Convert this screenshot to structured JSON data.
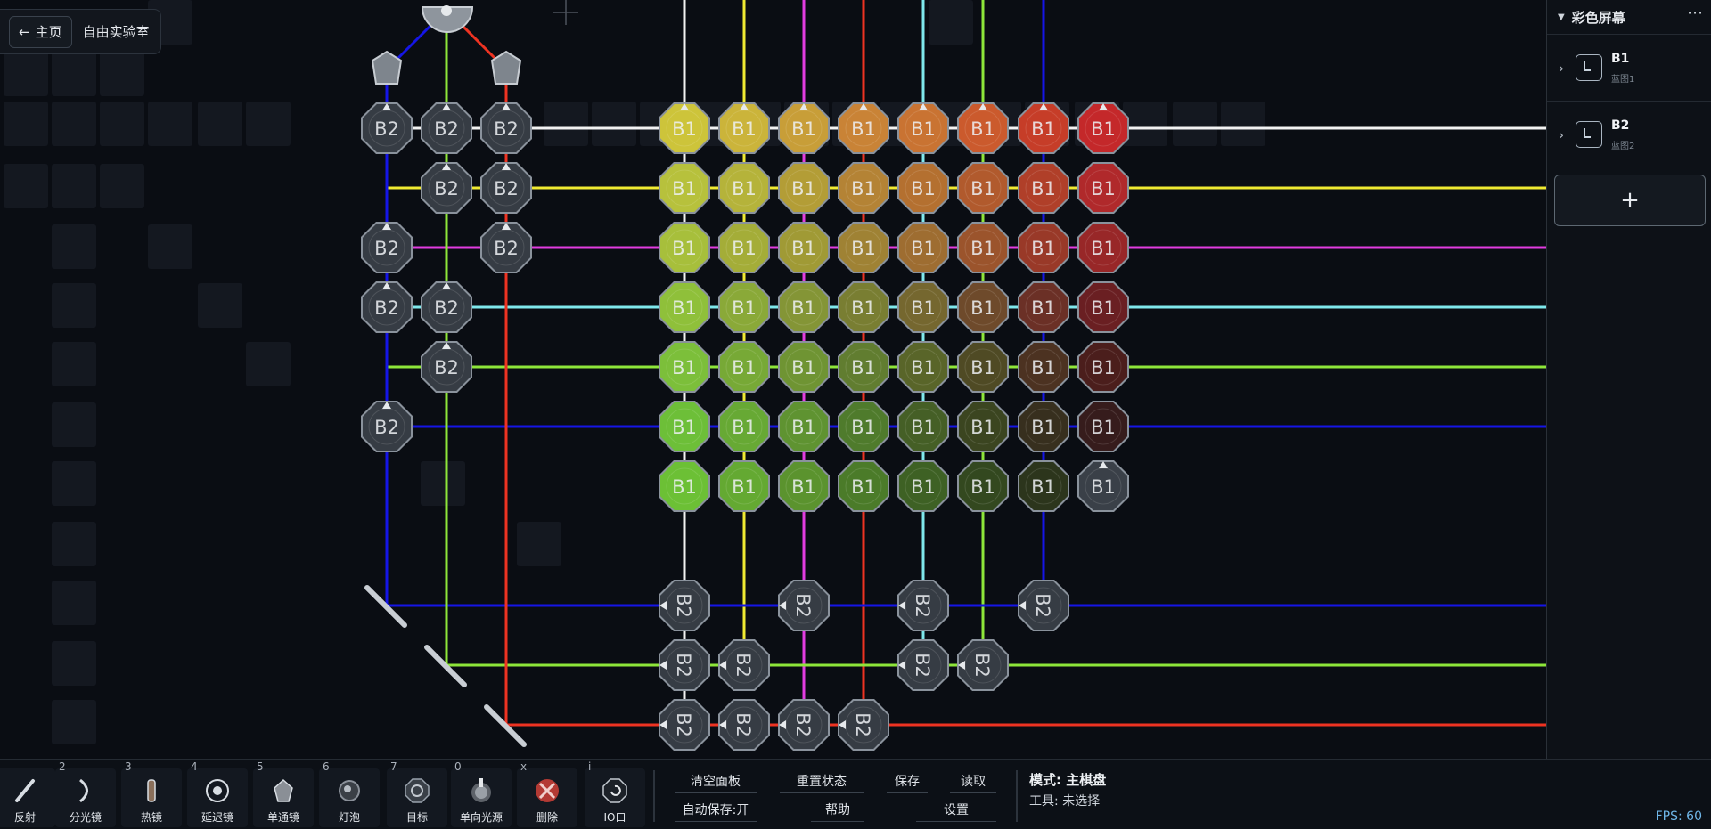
{
  "nav": {
    "home_label": "主页",
    "title": "自由实验室"
  },
  "sidebar": {
    "title": "彩色屏幕",
    "more_icon": "ellipsis-icon",
    "blueprints": [
      {
        "name": "B1",
        "sub": "蓝图1"
      },
      {
        "name": "B2",
        "sub": "蓝图2"
      }
    ],
    "add_label": "+"
  },
  "toolbar": {
    "tools": [
      {
        "key": "",
        "label": "反射",
        "icon": "mirror-icon"
      },
      {
        "key": "2",
        "label": "分光镜",
        "icon": "splitter-icon"
      },
      {
        "key": "3",
        "label": "热镜",
        "icon": "hot-mirror-icon"
      },
      {
        "key": "4",
        "label": "延迟镜",
        "icon": "delay-lens-icon"
      },
      {
        "key": "5",
        "label": "单通镜",
        "icon": "one-way-lens-icon"
      },
      {
        "key": "6",
        "label": "灯泡",
        "icon": "bulb-icon"
      },
      {
        "key": "7",
        "label": "目标",
        "icon": "target-icon"
      },
      {
        "key": "0",
        "label": "单向光源",
        "icon": "light-source-icon"
      },
      {
        "key": "x",
        "label": "删除",
        "icon": "delete-icon"
      },
      {
        "key": "i",
        "label": "IO口",
        "icon": "io-port-icon"
      }
    ],
    "controls": {
      "clear": "清空面板",
      "reset": "重置状态",
      "save": "保存",
      "load": "读取",
      "autosave": "自动保存:开",
      "help": "帮助",
      "settings": "设置"
    },
    "mode": "模式: 主棋盘",
    "tool": "工具: 未选择",
    "fps": "FPS: 60"
  },
  "board": {
    "node_labels": {
      "b1": "B1",
      "b2": "B2"
    },
    "beam_colors": {
      "white": "#f2f2f2",
      "yellow": "#f0ea32",
      "magenta": "#e23ce0",
      "red": "#ee3322",
      "cyan": "#7fe8ec",
      "green": "#8ee63a",
      "blue": "#1515e6"
    },
    "b1_colors": [
      [
        "#cdc43a",
        "#cbb43a",
        "#c89e38",
        "#c98336",
        "#c97332",
        "#cb5a2d",
        "#c63d28",
        "#c4282a"
      ],
      [
        "#b7c13c",
        "#b5b33a",
        "#b39d36",
        "#b48335",
        "#b47030",
        "#b15a2d",
        "#b03f29",
        "#b0292b"
      ],
      [
        "#a7bf3b",
        "#a4ad38",
        "#a09a35",
        "#9f8234",
        "#9e6d31",
        "#9b542c",
        "#993928",
        "#982728"
      ],
      [
        "#8fc03a",
        "#8aa938",
        "#849536",
        "#797e32",
        "#75672f",
        "#6e4a2b",
        "#6b3026",
        "#6a1f22"
      ],
      [
        "#7cbf3a",
        "#77a936",
        "#6f9433",
        "#617d30",
        "#596529",
        "#4f4a24",
        "#4c3221",
        "#4b1e1c"
      ],
      [
        "#6dbf38",
        "#67a934",
        "#5f9331",
        "#4f7b2c",
        "#455f26",
        "#3b4520",
        "#372f1e",
        "#361c1c"
      ],
      [
        "#6cc035",
        "#64a932",
        "#5b932e",
        "#4b7b29",
        "#3e6124",
        "#33481f",
        "#2c351c",
        null
      ]
    ]
  }
}
